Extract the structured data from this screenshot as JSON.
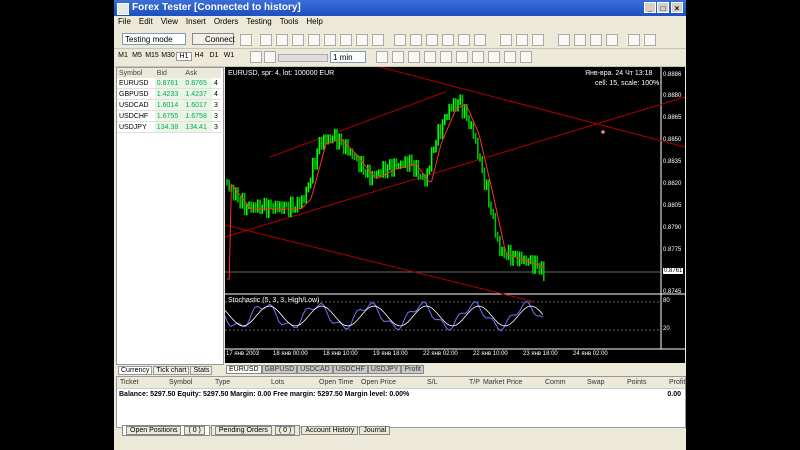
{
  "window": {
    "title": "Forex Tester [Connected to history]"
  },
  "menu": [
    "File",
    "Edit",
    "View",
    "Insert",
    "Orders",
    "Testing",
    "Tools",
    "Help"
  ],
  "toolbar": {
    "mode": "Testing mode",
    "connect_label": "Connect",
    "timeframe": "1 min",
    "timeframes": [
      "M1",
      "M5",
      "M15",
      "M30",
      "H1",
      "H4",
      "D1",
      "W1",
      "MN"
    ]
  },
  "symbols": {
    "headers": [
      "Symbol",
      "Bid",
      "Ask",
      ""
    ],
    "rows": [
      {
        "symbol": "EURUSD",
        "bid": "0.8761",
        "ask": "0.8765",
        "spread": "4"
      },
      {
        "symbol": "GBPUSD",
        "bid": "1.4233",
        "ask": "1.4237",
        "spread": "4"
      },
      {
        "symbol": "USDCAD",
        "bid": "1.6014",
        "ask": "1.6017",
        "spread": "3"
      },
      {
        "symbol": "USDCHF",
        "bid": "1.6755",
        "ask": "1.6758",
        "spread": "3"
      },
      {
        "symbol": "USDJPY",
        "bid": "134.38",
        "ask": "134.41",
        "spread": "3"
      }
    ]
  },
  "left_tabs": [
    "Currency",
    "Tick chart",
    "Stats"
  ],
  "chart": {
    "header": "EURUSD, spr: 4, lot: 100000 EUR",
    "info_line1": "Янв-вра. 24 Чт 13:18",
    "info_line2": "cell: 15, scale: 100%",
    "price_labels": [
      "0.8886",
      "0.8880",
      "0.8865",
      "0.8850",
      "0.8835",
      "0.8820",
      "0.8805",
      "0.8790",
      "0.8775",
      "0.8760",
      "0.8745"
    ],
    "current_price": "0.8761",
    "oscillator_label": "Stochastic (5, 3, 3, High/Low)",
    "osc_levels": [
      "80",
      "20"
    ],
    "time_labels": [
      "17 янв 2003",
      "18 янв 00:00",
      "18 янв 10:00",
      "19 янв 18:00",
      "22 янв 02:00",
      "22 янв 10:00",
      "23 янв 18:00",
      "24 янв 02:00"
    ]
  },
  "chart_tabs": [
    "EURUSD",
    "GBPUSD",
    "USDCAD",
    "USDCHF",
    "USDJPY",
    "Profit"
  ],
  "orders": {
    "columns": [
      "Ticket",
      "Symbol",
      "Type",
      "Lots",
      "Open Time",
      "Open Price",
      "S/L",
      "T/P",
      "Market Price",
      "Comm",
      "Swap",
      "Points",
      "Profit"
    ],
    "balance_line": "Balance: 5297.50 Equity: 5297.50 Margin: 0.00 Free margin: 5297.50 Margin level: 0.00%",
    "balance_profit": "0.00"
  },
  "bottom_tabs": [
    "Open Positions",
    "( 0 )",
    "Pending Orders",
    "( 0 )",
    "Account History",
    "Journal"
  ],
  "colors": {
    "bull": "#00ff00",
    "bear": "#00c000",
    "ma": "#ff3030",
    "trendline": "#b00000",
    "stoch_main": "#7070ff",
    "stoch_signal": "#ffffff"
  }
}
